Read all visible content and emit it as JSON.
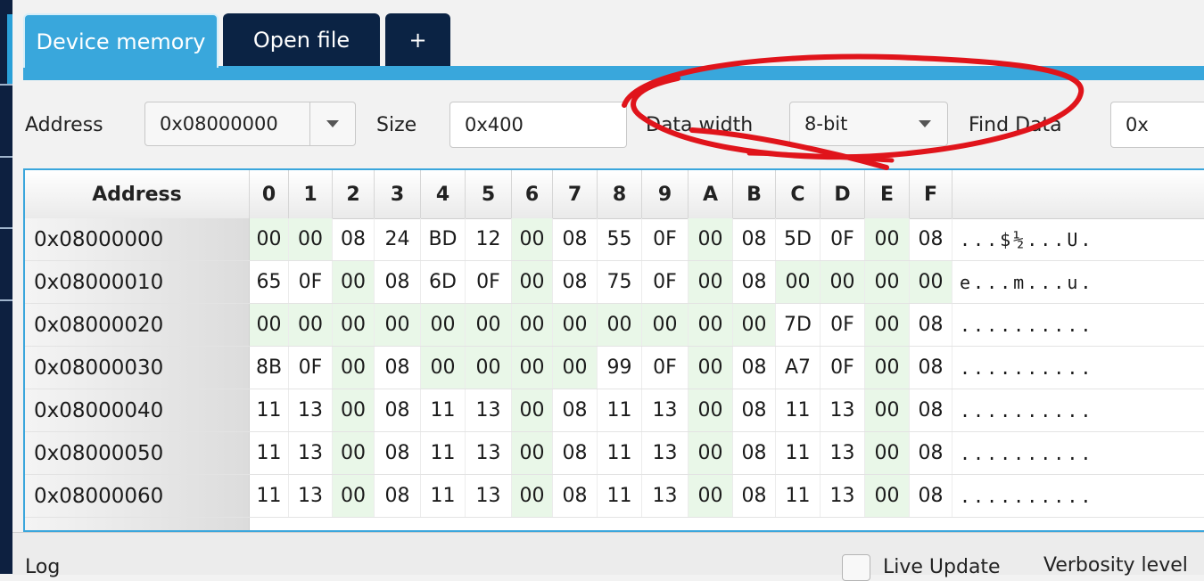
{
  "tabs": [
    {
      "label": "Device memory",
      "active": true
    },
    {
      "label": "Open file",
      "active": false
    },
    {
      "label": "+",
      "active": false
    }
  ],
  "toolbar": {
    "address_label": "Address",
    "address_value": "0x08000000",
    "size_label": "Size",
    "size_value": "0x400",
    "data_width_label": "Data width",
    "data_width_value": "8-bit",
    "find_data_label": "Find Data",
    "find_data_value": "0x"
  },
  "table": {
    "headers": [
      "Address",
      "0",
      "1",
      "2",
      "3",
      "4",
      "5",
      "6",
      "7",
      "8",
      "9",
      "A",
      "B",
      "C",
      "D",
      "E",
      "F"
    ],
    "rows": [
      {
        "address": "0x08000000",
        "bytes": [
          "00",
          "00",
          "08",
          "24",
          "BD",
          "12",
          "00",
          "08",
          "55",
          "0F",
          "00",
          "08",
          "5D",
          "0F",
          "00",
          "08"
        ],
        "ascii": "...$½...U."
      },
      {
        "address": "0x08000010",
        "bytes": [
          "65",
          "0F",
          "00",
          "08",
          "6D",
          "0F",
          "00",
          "08",
          "75",
          "0F",
          "00",
          "08",
          "00",
          "00",
          "00",
          "00"
        ],
        "ascii": "e...m...u."
      },
      {
        "address": "0x08000020",
        "bytes": [
          "00",
          "00",
          "00",
          "00",
          "00",
          "00",
          "00",
          "00",
          "00",
          "00",
          "00",
          "00",
          "7D",
          "0F",
          "00",
          "08"
        ],
        "ascii": ".........."
      },
      {
        "address": "0x08000030",
        "bytes": [
          "8B",
          "0F",
          "00",
          "08",
          "00",
          "00",
          "00",
          "00",
          "99",
          "0F",
          "00",
          "08",
          "A7",
          "0F",
          "00",
          "08"
        ],
        "ascii": ".........."
      },
      {
        "address": "0x08000040",
        "bytes": [
          "11",
          "13",
          "00",
          "08",
          "11",
          "13",
          "00",
          "08",
          "11",
          "13",
          "00",
          "08",
          "11",
          "13",
          "00",
          "08"
        ],
        "ascii": ".........."
      },
      {
        "address": "0x08000050",
        "bytes": [
          "11",
          "13",
          "00",
          "08",
          "11",
          "13",
          "00",
          "08",
          "11",
          "13",
          "00",
          "08",
          "11",
          "13",
          "00",
          "08"
        ],
        "ascii": ".........."
      },
      {
        "address": "0x08000060",
        "bytes": [
          "11",
          "13",
          "00",
          "08",
          "11",
          "13",
          "00",
          "08",
          "11",
          "13",
          "00",
          "08",
          "11",
          "13",
          "00",
          "08"
        ],
        "ascii": ".........."
      }
    ]
  },
  "bottom": {
    "log_label": "Log",
    "live_update_label": "Live Update",
    "verbosity_label": "Verbosity level"
  },
  "colors": {
    "tab_active": "#39a7dc",
    "tab_inactive": "#0b2344",
    "zero_cell_bg": "#e9f7e8",
    "annotation_red": "#e0141b"
  }
}
